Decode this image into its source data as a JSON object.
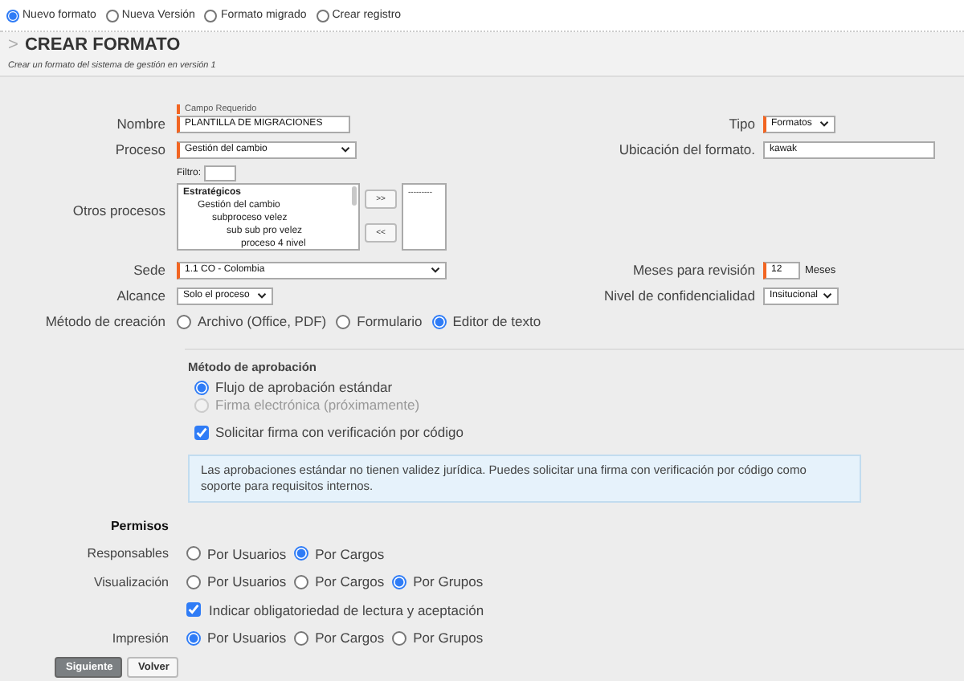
{
  "mode_options": [
    {
      "label": "Nuevo formato",
      "selected": true
    },
    {
      "label": "Nueva Versión",
      "selected": false
    },
    {
      "label": "Formato migrado",
      "selected": false
    },
    {
      "label": "Crear registro",
      "selected": false
    }
  ],
  "header": {
    "chevron": ">",
    "title": "CREAR FORMATO",
    "subtitle": "Crear un formato del sistema de gestión en versión 1"
  },
  "required_legend": "Campo Requerido",
  "top_rows": [
    {
      "left": {
        "label": "Nombre",
        "kind": "text",
        "value": "PLANTILLA DE MIGRACIONES",
        "required": true
      },
      "right": {
        "label": "Tipo",
        "kind": "select",
        "value": "Formatos",
        "required": true
      }
    },
    {
      "left": {
        "label": "Proceso",
        "kind": "select",
        "value": "Gestión del cambio",
        "required": true
      },
      "right": {
        "label": "Ubicación del formato.",
        "kind": "text",
        "value": "kawak",
        "required": false
      }
    }
  ],
  "other_processes": {
    "label": "Otros procesos",
    "filter_label": "Filtro:",
    "available": [
      {
        "label": "Estratégicos",
        "children": [
          {
            "label": "Gestión del cambio",
            "children": [
              {
                "label": "subproceso velez",
                "children": [
                  {
                    "label": "sub sub pro velez",
                    "children": [
                      {
                        "label": "proceso 4 nivel"
                      }
                    ]
                  }
                ]
              }
            ]
          }
        ]
      }
    ],
    "chosen": [
      "---------"
    ],
    "add_button": ">>",
    "remove_button": "<<"
  },
  "bottom_rows": [
    {
      "left": {
        "label": "Sede",
        "kind": "select",
        "value": "1.1 CO - Colombia",
        "required": true
      },
      "right": {
        "label": "Meses para revisión",
        "kind": "text",
        "value": "12",
        "suffix": "Meses",
        "required": true
      }
    },
    {
      "left": {
        "label": "Alcance",
        "kind": "select",
        "value": "Solo el proceso",
        "required": false
      },
      "right": {
        "label": "Nivel de confidencialidad",
        "kind": "select",
        "value": "Insitucional",
        "required": false
      }
    }
  ],
  "creation_method": {
    "label": "Método de creación",
    "options": [
      {
        "label": "Archivo (Office, PDF)",
        "selected": false
      },
      {
        "label": "Formulario",
        "selected": false
      },
      {
        "label": "Editor de texto",
        "selected": true
      }
    ]
  },
  "approval": {
    "title": "Método de aprobación",
    "options": [
      {
        "label": "Flujo de aprobación estándar",
        "selected": true,
        "disabled": false
      },
      {
        "label": "Firma electrónica (próximamente)",
        "selected": false,
        "disabled": true
      }
    ],
    "code_check": {
      "label": "Solicitar firma con verificación por código",
      "checked": true
    },
    "info": "Las aprobaciones estándar no tienen validez jurídica. Puedes solicitar una firma con verificación por código como soporte para requisitos internos."
  },
  "permissions": {
    "title": "Permisos",
    "rows": [
      {
        "kind": "radios",
        "label": "Responsables",
        "options": [
          {
            "label": "Por Usuarios",
            "selected": false
          },
          {
            "label": "Por Cargos",
            "selected": true
          }
        ]
      },
      {
        "kind": "radios",
        "label": "Visualización",
        "options": [
          {
            "label": "Por Usuarios",
            "selected": false
          },
          {
            "label": "Por Cargos",
            "selected": false
          },
          {
            "label": "Por Grupos",
            "selected": true
          }
        ]
      },
      {
        "kind": "checkbox",
        "label": "Indicar obligatoriedad de lectura y aceptación",
        "checked": true
      },
      {
        "kind": "radios",
        "label": "Impresión",
        "options": [
          {
            "label": "Por Usuarios",
            "selected": true
          },
          {
            "label": "Por Cargos",
            "selected": false
          },
          {
            "label": "Por Grupos",
            "selected": false
          }
        ]
      }
    ]
  },
  "buttons": [
    {
      "label": "Siguiente",
      "kind": "primary"
    },
    {
      "label": "Volver",
      "kind": "secondary"
    }
  ]
}
